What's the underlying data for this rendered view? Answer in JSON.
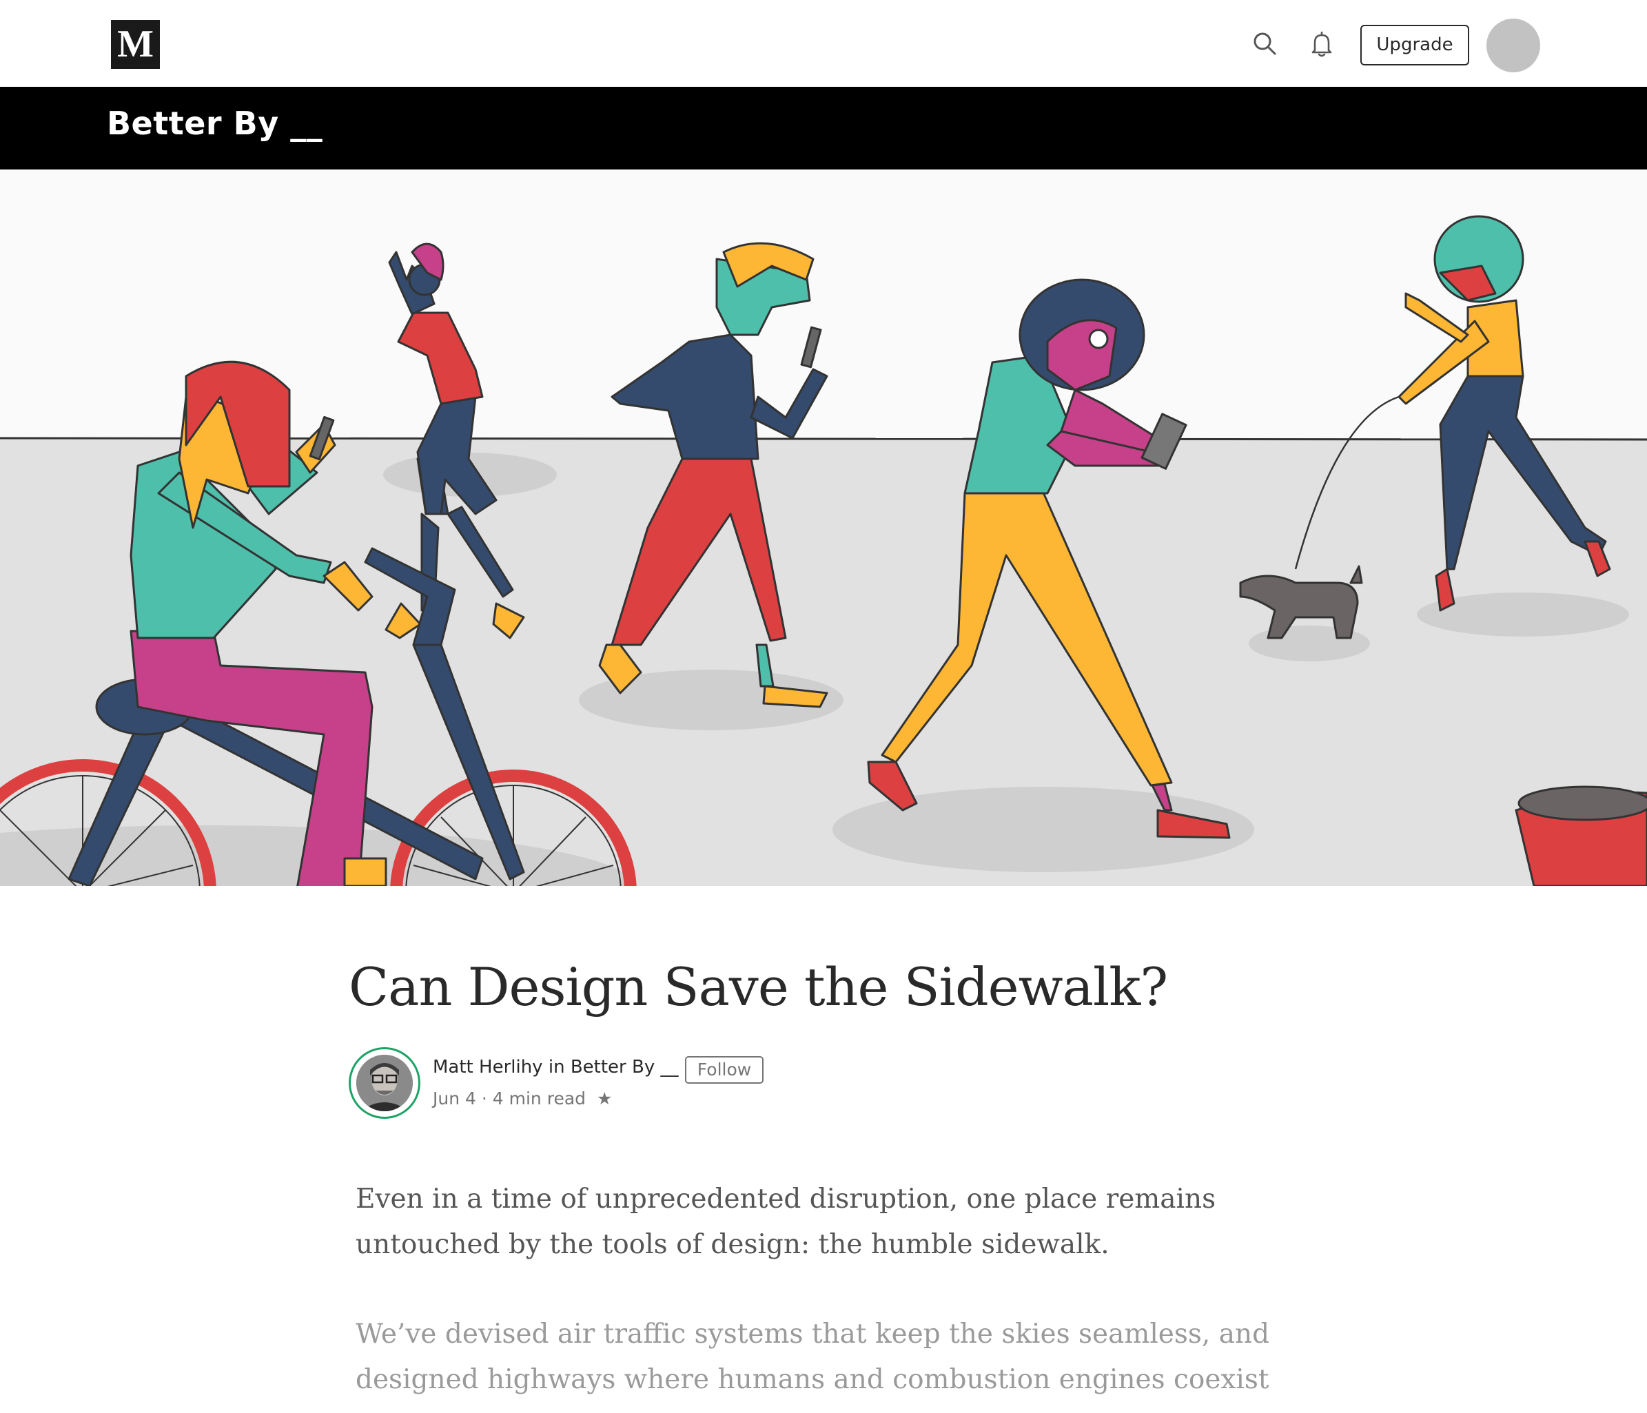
{
  "topbar": {
    "logo_letter": "M",
    "upgrade_label": "Upgrade",
    "icons": [
      "search-icon",
      "bell-icon"
    ]
  },
  "publication": {
    "name": "Better By __"
  },
  "article": {
    "title": "Can Design Save the Sidewalk?",
    "author": "Matt Herlihy",
    "in_word": "in",
    "publication": "Better By __",
    "follow_label": "Follow",
    "date": "Jun 4",
    "separator": "·",
    "read_time": "4 min read",
    "star": "★",
    "paragraphs": [
      "Even in a time of unprecedented disruption, one place remains untouched by the tools of design: the humble sidewalk.",
      "We’ve devised air traffic systems that keep the skies seamless, and designed highways where humans and combustion engines coexist without chaos."
    ]
  },
  "colors": {
    "hero_sky": "#fbfafb",
    "hero_ground": "#e2e1e1",
    "teal": "#4dbfaa",
    "navy": "#344b6e",
    "red": "#dd4040",
    "magenta": "#c6418a",
    "yellow": "#fdb734",
    "accent_green": "#1ea366"
  }
}
